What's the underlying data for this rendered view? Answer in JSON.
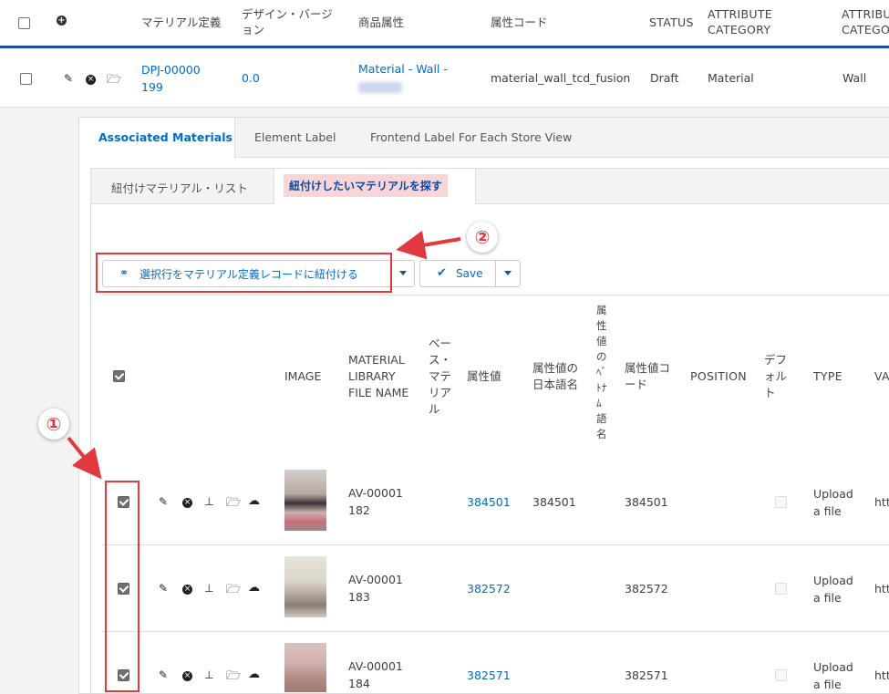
{
  "top_table": {
    "headers": {
      "material_def": "マテリアル定義",
      "design_version": "デザイン・バージョン",
      "product_attribute": "商品属性",
      "attribute_code": "属性コード",
      "status": "STATUS",
      "attribute_category": "ATTRIBUTE CATEGORY",
      "attribute_category_2": "ATTRIBU CATEGO"
    },
    "row": {
      "material_def": "DPJ-00000199",
      "design_version": "0.0",
      "product_attribute": "Material - Wall -",
      "attribute_code": "material_wall_tcd_fusion",
      "status": "Draft",
      "attribute_category": "Material",
      "attribute_category_2": "Wall"
    }
  },
  "tabs": {
    "associated": "Associated Materials",
    "element_label": "Element Label",
    "frontend_label": "Frontend Label For Each Store View"
  },
  "subtabs": {
    "list": "紐付けマテリアル・リスト",
    "search": "紐付けしたいマテリアルを探す"
  },
  "toolbar": {
    "link_button": "選択行をマテリアル定義レコードに紐付ける",
    "save_button": "Save"
  },
  "grid": {
    "headers": {
      "image": "IMAGE",
      "file_name": "MATERIAL LIBRARY FILE NAME",
      "base_material": "ベース・マテリアル",
      "attr_value": "属性値",
      "attr_value_ja": "属性値の日本語名",
      "attr_value_vn": "属性値のﾍﾞﾄﾅﾑ語名",
      "attr_code": "属性値コード",
      "position": "POSITION",
      "default": "デフォルト",
      "type": "TYPE",
      "va": "VA"
    },
    "rows": [
      {
        "file_name": "AV-00001182",
        "attr_value": "384501",
        "attr_value_ja": "384501",
        "attr_code": "384501",
        "type": "Upload a file",
        "va": "htt"
      },
      {
        "file_name": "AV-00001183",
        "attr_value": "382572",
        "attr_value_ja": "",
        "attr_code": "382572",
        "type": "Upload a file",
        "va": "htt"
      },
      {
        "file_name": "AV-00001184",
        "attr_value": "382571",
        "attr_value_ja": "",
        "attr_code": "382571",
        "type": "Upload a file",
        "va": "htt"
      }
    ]
  },
  "annotations": {
    "one": "①",
    "two": "②"
  },
  "colors": {
    "accent_blue": "#006dcc",
    "annotation_red": "#e0393e",
    "header_rule": "#1b5297"
  }
}
